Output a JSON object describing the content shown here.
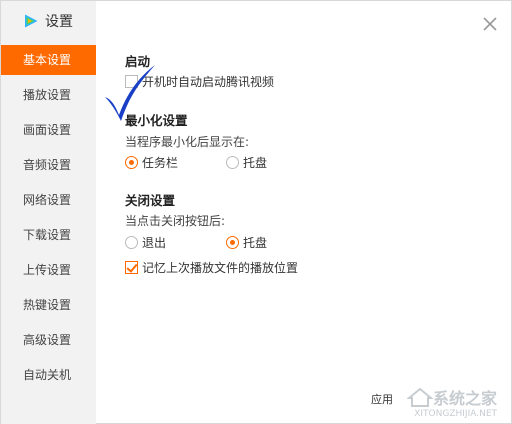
{
  "window": {
    "title": "设置",
    "brand_color": "#ff6a00"
  },
  "sidebar": {
    "items": [
      {
        "label": "基本设置",
        "active": true
      },
      {
        "label": "播放设置",
        "active": false
      },
      {
        "label": "画面设置",
        "active": false
      },
      {
        "label": "音频设置",
        "active": false
      },
      {
        "label": "网络设置",
        "active": false
      },
      {
        "label": "下载设置",
        "active": false
      },
      {
        "label": "上传设置",
        "active": false
      },
      {
        "label": "热键设置",
        "active": false
      },
      {
        "label": "高级设置",
        "active": false
      },
      {
        "label": "自动关机",
        "active": false
      }
    ]
  },
  "startup": {
    "title": "启动",
    "autostart_label": "开机时自动启动腾讯视频",
    "autostart_checked": true
  },
  "minimize": {
    "title": "最小化设置",
    "prompt": "当程序最小化后显示在:",
    "option_taskbar": "任务栏",
    "option_tray": "托盘",
    "selected": "任务栏"
  },
  "close_settings": {
    "title": "关闭设置",
    "prompt": "当点击关闭按钮后:",
    "option_exit": "退出",
    "option_tray": "托盘",
    "selected": "托盘",
    "remember_label": "记忆上次播放文件的播放位置",
    "remember_checked": true
  },
  "footer": {
    "partial_button": "应用",
    "watermark": "系统之家",
    "watermark_url": "XITONGZHIJIA.NET"
  },
  "icons": {
    "logo": "tencent-video-logo-icon",
    "close": "close-icon",
    "annotation": "checkmark-annotation-icon"
  }
}
